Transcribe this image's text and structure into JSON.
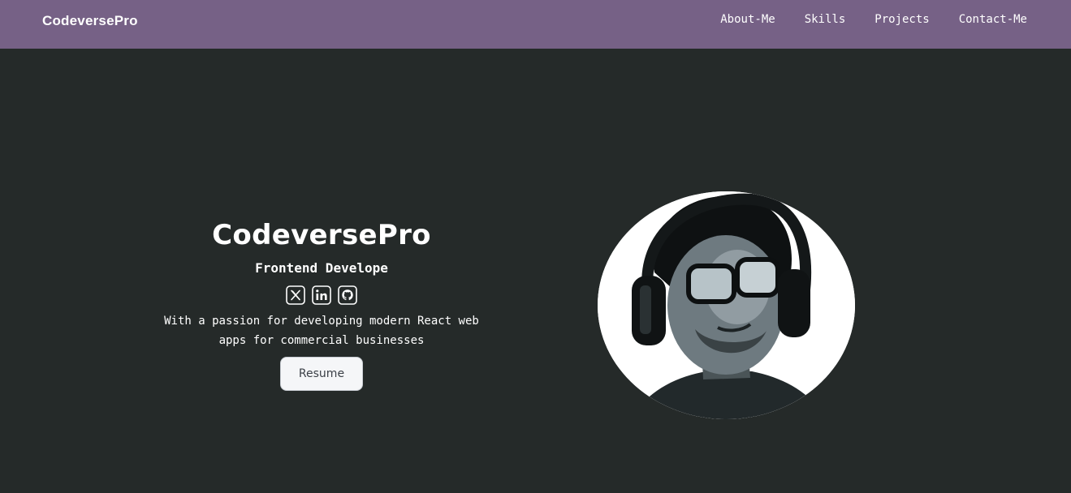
{
  "header": {
    "brand": "CodeversePro",
    "nav": [
      {
        "label": "About-Me"
      },
      {
        "label": "Skills"
      },
      {
        "label": "Projects"
      },
      {
        "label": "Contact-Me"
      }
    ]
  },
  "hero": {
    "title": "CodeversePro",
    "role": "Frontend Develope",
    "social_icons": [
      "x-icon",
      "linkedin-icon",
      "github-icon"
    ],
    "description": "With a passion for developing modern React web apps for commercial businesses",
    "resume_label": "Resume"
  },
  "colors": {
    "navbar": "#766186",
    "background": "#252a29",
    "text": "#ffffff",
    "button_bg": "#f5f6f8"
  }
}
